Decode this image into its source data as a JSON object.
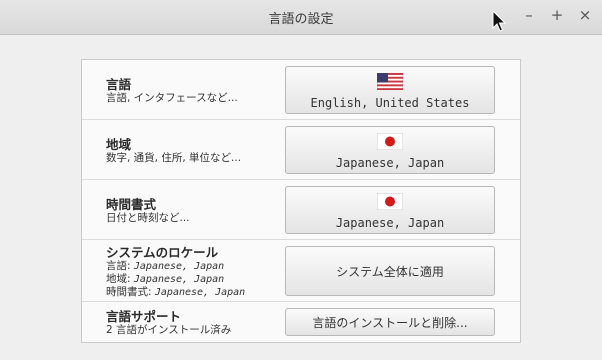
{
  "window": {
    "title": "言語の設定",
    "minimize": "–",
    "maximize": "+",
    "close": "×"
  },
  "rows": [
    {
      "heading": "言語",
      "sub": "言語, インタフェースなど...",
      "button": {
        "label": "English, United States",
        "icon": "us-flag-icon"
      }
    },
    {
      "heading": "地域",
      "sub": "数字, 通貨, 住所, 単位など...",
      "button": {
        "label": "Japanese, Japan",
        "icon": "jp-flag-icon"
      }
    },
    {
      "heading": "時間書式",
      "sub": "日付と時刻など...",
      "button": {
        "label": "Japanese, Japan",
        "icon": "jp-flag-icon"
      }
    },
    {
      "heading": "システムのロケール",
      "sub_lines": [
        {
          "key": "言語: ",
          "value": "Japanese, Japan"
        },
        {
          "key": "地域: ",
          "value": "Japanese, Japan"
        },
        {
          "key": "時間書式: ",
          "value": "Japanese, Japan"
        }
      ],
      "button": {
        "label": "システム全体に適用"
      }
    },
    {
      "heading": "言語サポート",
      "sub": "2 言語がインストール済み",
      "button": {
        "label": "言語のインストールと削除..."
      }
    }
  ],
  "colors": {
    "jp_red": "#d11a1a",
    "us_red": "#c9343f",
    "us_blue": "#3c3b6e"
  }
}
